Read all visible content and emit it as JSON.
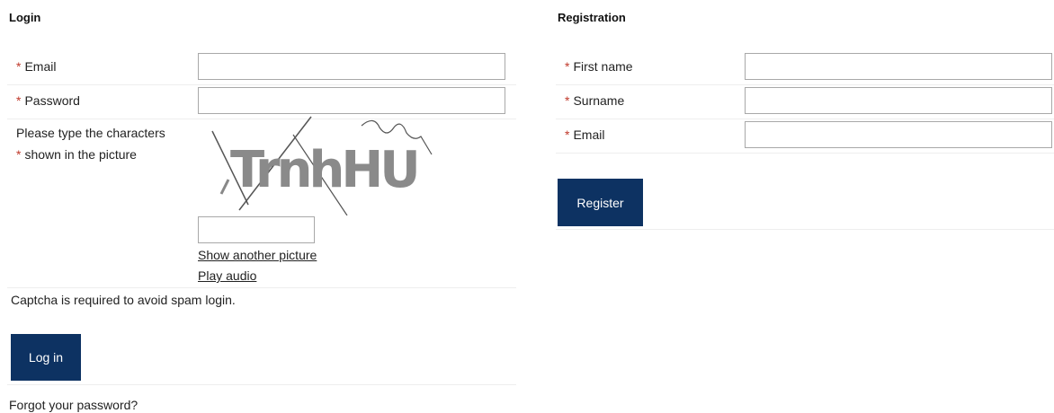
{
  "login": {
    "heading": "Login",
    "required_mark": "*",
    "email_label": "Email",
    "email_value": "",
    "password_label": "Password",
    "password_value": "",
    "captcha_label_line1": "Please type the characters",
    "captcha_label_line2": "shown in the picture",
    "captcha_text": "TrnhHU",
    "captcha_value": "",
    "show_another_picture": "Show another picture",
    "play_audio": "Play audio",
    "captcha_note": "Captcha is required to avoid spam login.",
    "login_button": "Log in",
    "forgot_password": "Forgot your password?"
  },
  "registration": {
    "heading": "Registration",
    "required_mark": "*",
    "first_name_label": "First name",
    "first_name_value": "",
    "surname_label": "Surname",
    "surname_value": "",
    "email_label": "Email",
    "email_value": "",
    "register_button": "Register"
  },
  "colors": {
    "button_bg": "#0d3262",
    "required_star": "#c0392b",
    "input_border": "#a8a8a8"
  }
}
